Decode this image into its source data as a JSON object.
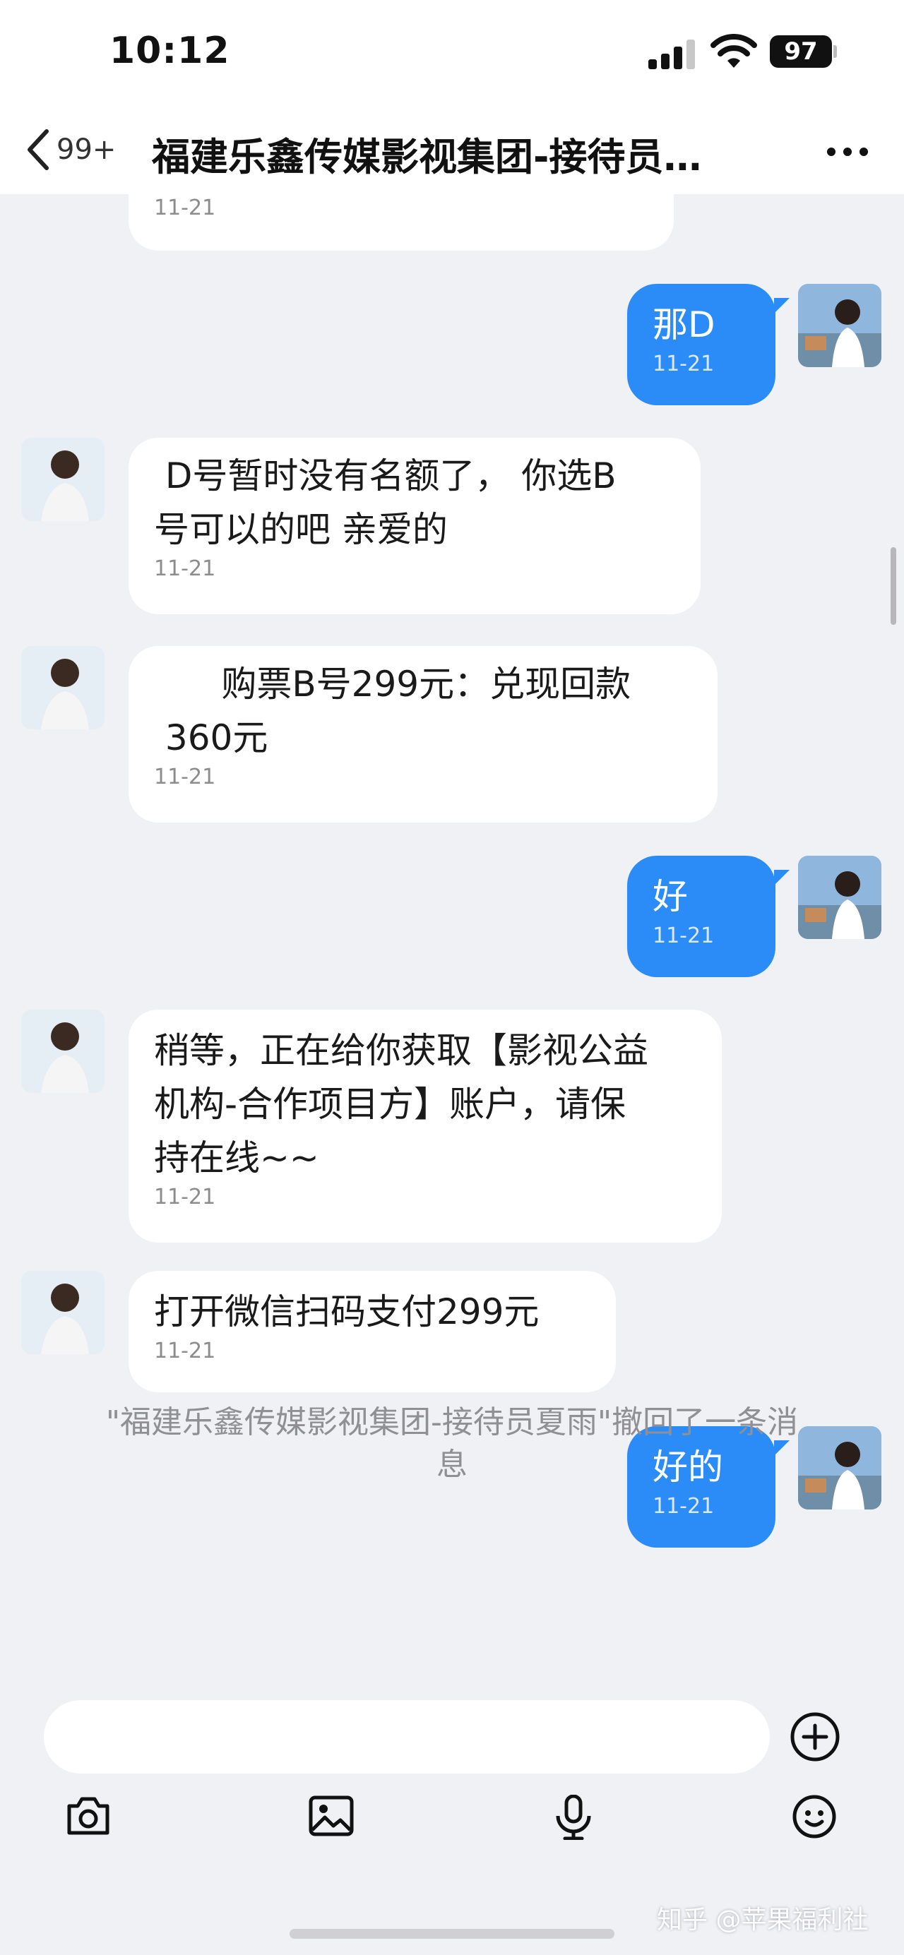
{
  "status_bar": {
    "time": "10:12",
    "battery": "97"
  },
  "nav": {
    "back_count": "99+",
    "title": "福建乐鑫传媒影视集团-接待员…"
  },
  "messages": [
    {
      "side": "in",
      "text": "",
      "time": "11-21"
    },
    {
      "side": "out",
      "text": "那D",
      "time": "11-21"
    },
    {
      "side": "in",
      "text": " D号暂时没有名额了， 你选B\n号可以的吧 亲爱的",
      "time": "11-21"
    },
    {
      "side": "in",
      "text": "      购票B号299元：兑现回款\n 360元",
      "time": "11-21"
    },
    {
      "side": "out",
      "text": "好",
      "time": "11-21"
    },
    {
      "side": "in",
      "text": "稍等，正在给你获取【影视公益\n机构-合作项目方】账户，请保\n持在线~~",
      "time": "11-21"
    },
    {
      "side": "in",
      "text": "打开微信扫码支付299元",
      "time": "11-21"
    },
    {
      "side": "out",
      "text": "好的",
      "time": "11-21"
    }
  ],
  "system_note": "\"福建乐鑫传媒影视集团-接待员夏雨\"撤回了一条消息",
  "input": {
    "placeholder": ""
  },
  "toolbar": {
    "icons": [
      "camera-icon",
      "image-icon",
      "microphone-icon",
      "emoji-icon"
    ]
  },
  "watermark": "知乎 @苹果福利社",
  "colors": {
    "background": "#f0f1f5",
    "outgoing_bubble": "#2b8cf8",
    "incoming_bubble": "#ffffff"
  }
}
